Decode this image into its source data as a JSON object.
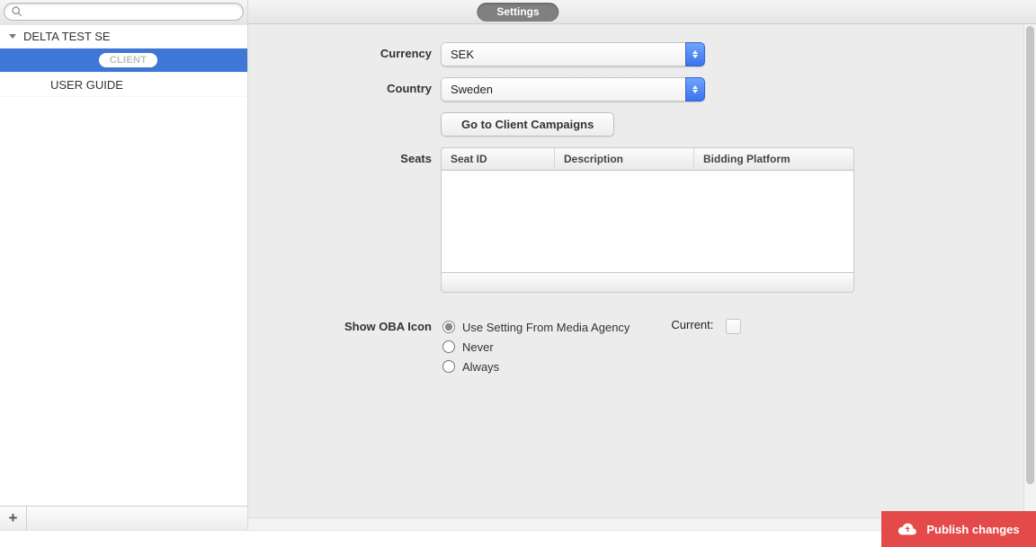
{
  "header": {
    "search_placeholder": "",
    "tab_label": "Settings"
  },
  "sidebar": {
    "root_label": "DELTA TEST SE",
    "selected_chip": "CLIENT",
    "child_label": "USER GUIDE",
    "add_symbol": "+"
  },
  "form": {
    "currency_label": "Currency",
    "currency_value": "SEK",
    "country_label": "Country",
    "country_value": "Sweden",
    "goto_button": "Go to Client Campaigns",
    "seats_label": "Seats",
    "seats_columns": {
      "seat_id": "Seat ID",
      "description": "Description",
      "bidding": "Bidding Platform"
    },
    "oba_label": "Show OBA Icon",
    "oba_options": {
      "use_setting": "Use Setting From Media Agency",
      "never": "Never",
      "always": "Always"
    },
    "current_label": "Current:"
  },
  "footer": {
    "publish_label": "Publish changes"
  }
}
